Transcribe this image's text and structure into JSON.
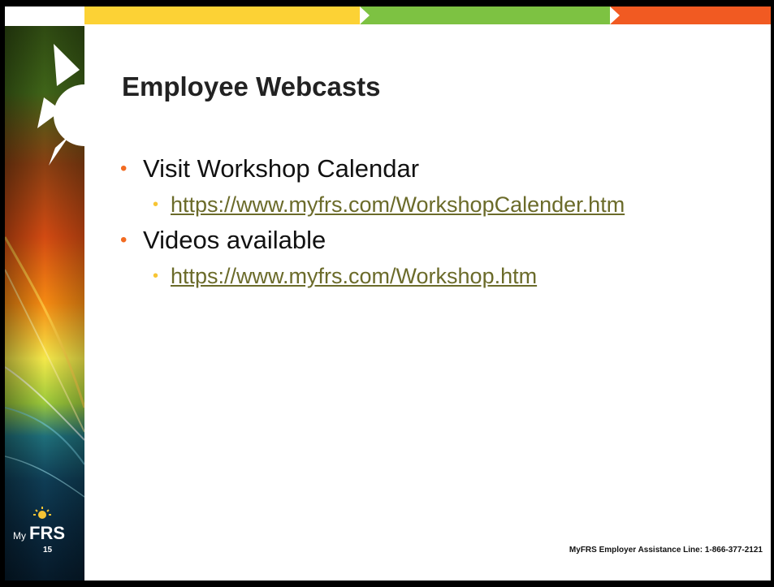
{
  "slide": {
    "title": "Employee Webcasts",
    "bullets": [
      {
        "text": "Visit Workshop Calendar",
        "sub": "https://www.myfrs.com/WorkshopCalender.htm"
      },
      {
        "text": "Videos available",
        "sub": "https://www.myfrs.com/Workshop.htm"
      }
    ],
    "page_number": "15",
    "footer": "MyFRS Employer Assistance Line: 1-866-377-2121",
    "logo": {
      "prefix": "My",
      "main": "FRS"
    }
  },
  "colors": {
    "bar_yellow": "#FCD235",
    "bar_green": "#7DC242",
    "bar_orange": "#F15A22",
    "bullet": "#F26B21",
    "sub_bullet": "#F7C534",
    "link": "#6B6B2A"
  }
}
